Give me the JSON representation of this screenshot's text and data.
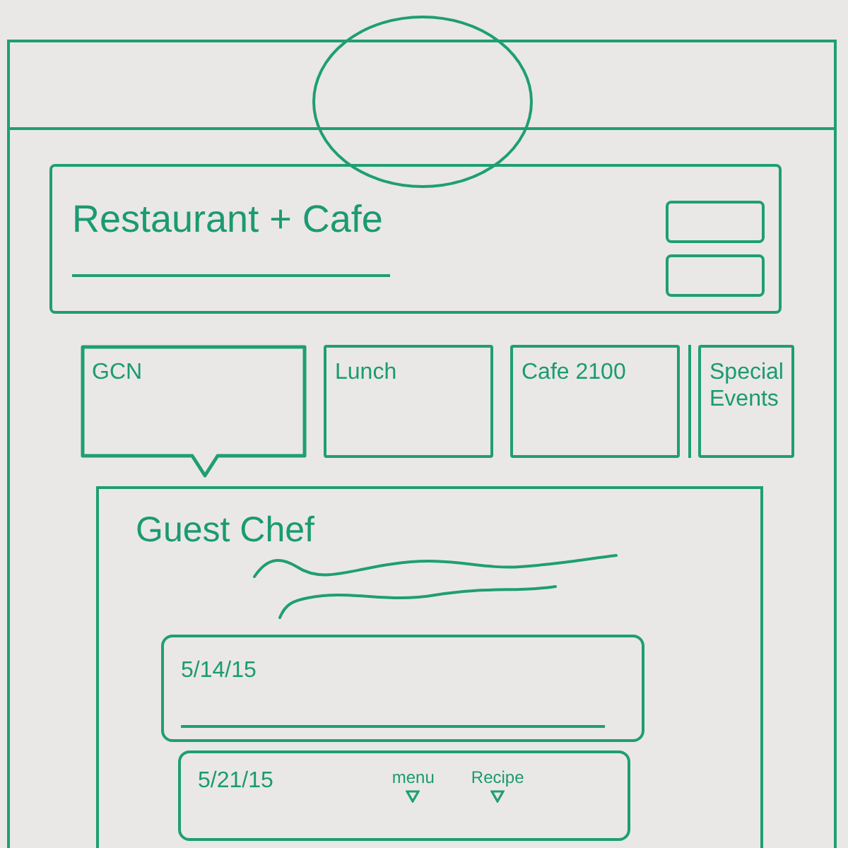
{
  "header": {
    "title": "Restaurant + Cafe"
  },
  "tabs": [
    {
      "label": "GCN",
      "selected": true
    },
    {
      "label": "Lunch",
      "selected": false
    },
    {
      "label": "Cafe 2100",
      "selected": false
    },
    {
      "label": "Special Events",
      "selected": false
    }
  ],
  "panel": {
    "title": "Guest Chef",
    "entries": [
      {
        "date": "5/14/15"
      },
      {
        "date": "5/21/15",
        "links": [
          "menu",
          "Recipe"
        ]
      }
    ]
  }
}
